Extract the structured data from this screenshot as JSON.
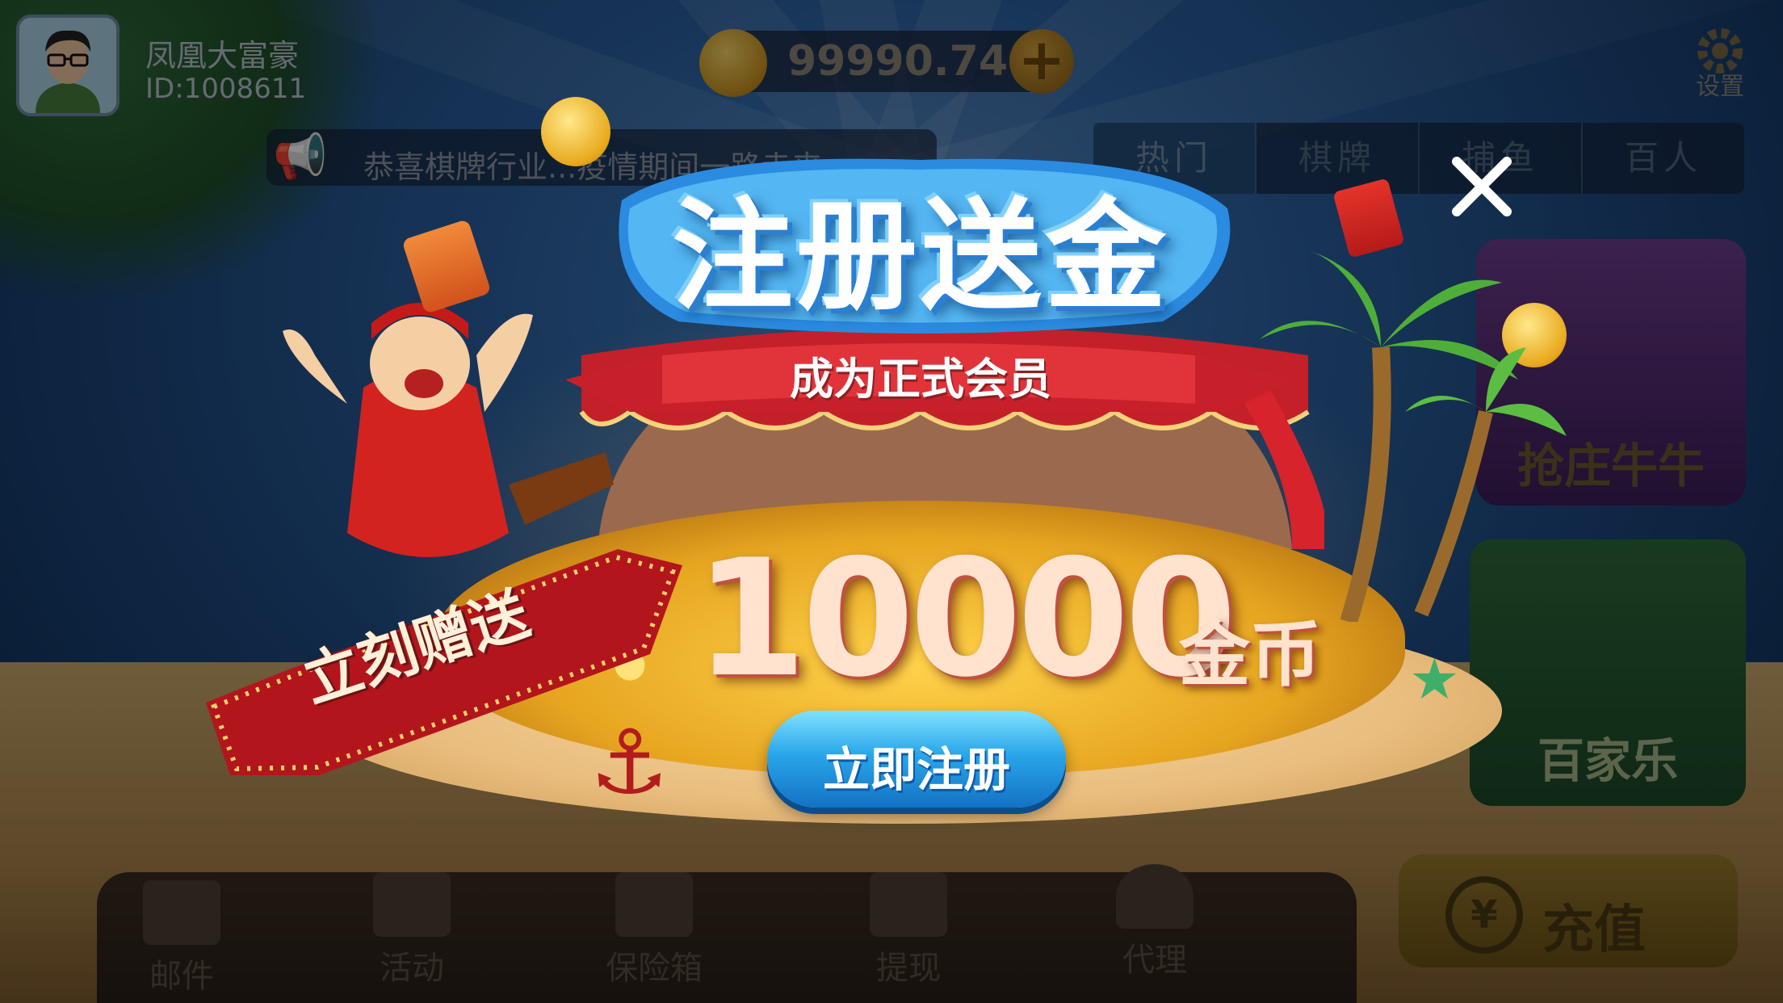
{
  "player": {
    "name": "凤凰大富豪",
    "id": "ID:1008611"
  },
  "balance": {
    "amount": "99990.74",
    "add_label": "+"
  },
  "settings": {
    "label": "设置"
  },
  "announcement": {
    "text": "恭喜棋牌行业...疫情期间一路走来"
  },
  "category_tabs": [
    {
      "label": "热门",
      "active": true
    },
    {
      "label": "棋牌",
      "active": false
    },
    {
      "label": "捕鱼",
      "active": false
    },
    {
      "label": "百人",
      "active": false
    }
  ],
  "game_tiles": [
    {
      "label": "抢庄牛牛"
    },
    {
      "label": "百家乐"
    }
  ],
  "bottom_nav": [
    {
      "label": "邮件",
      "icon": "mail-icon"
    },
    {
      "label": "活动",
      "icon": "gift-icon"
    },
    {
      "label": "保险箱",
      "icon": "safe-icon"
    },
    {
      "label": "提现",
      "icon": "withdraw-icon"
    },
    {
      "label": "代理",
      "icon": "agent-icon"
    }
  ],
  "recharge": {
    "label": "充值",
    "icon": "¥"
  },
  "popup": {
    "title": "注册送金",
    "subtitle": "成为正式会员",
    "gift_label": "立刻赠送",
    "reward_amount": "10000",
    "reward_unit": "金币",
    "register_button": "立即注册",
    "close_symbol": "✕"
  },
  "colors": {
    "accent_blue": "#2aa6ea",
    "title_outline": "#2a7fd1",
    "ribbon_red": "#c0232a",
    "gold": "#e6a520"
  }
}
